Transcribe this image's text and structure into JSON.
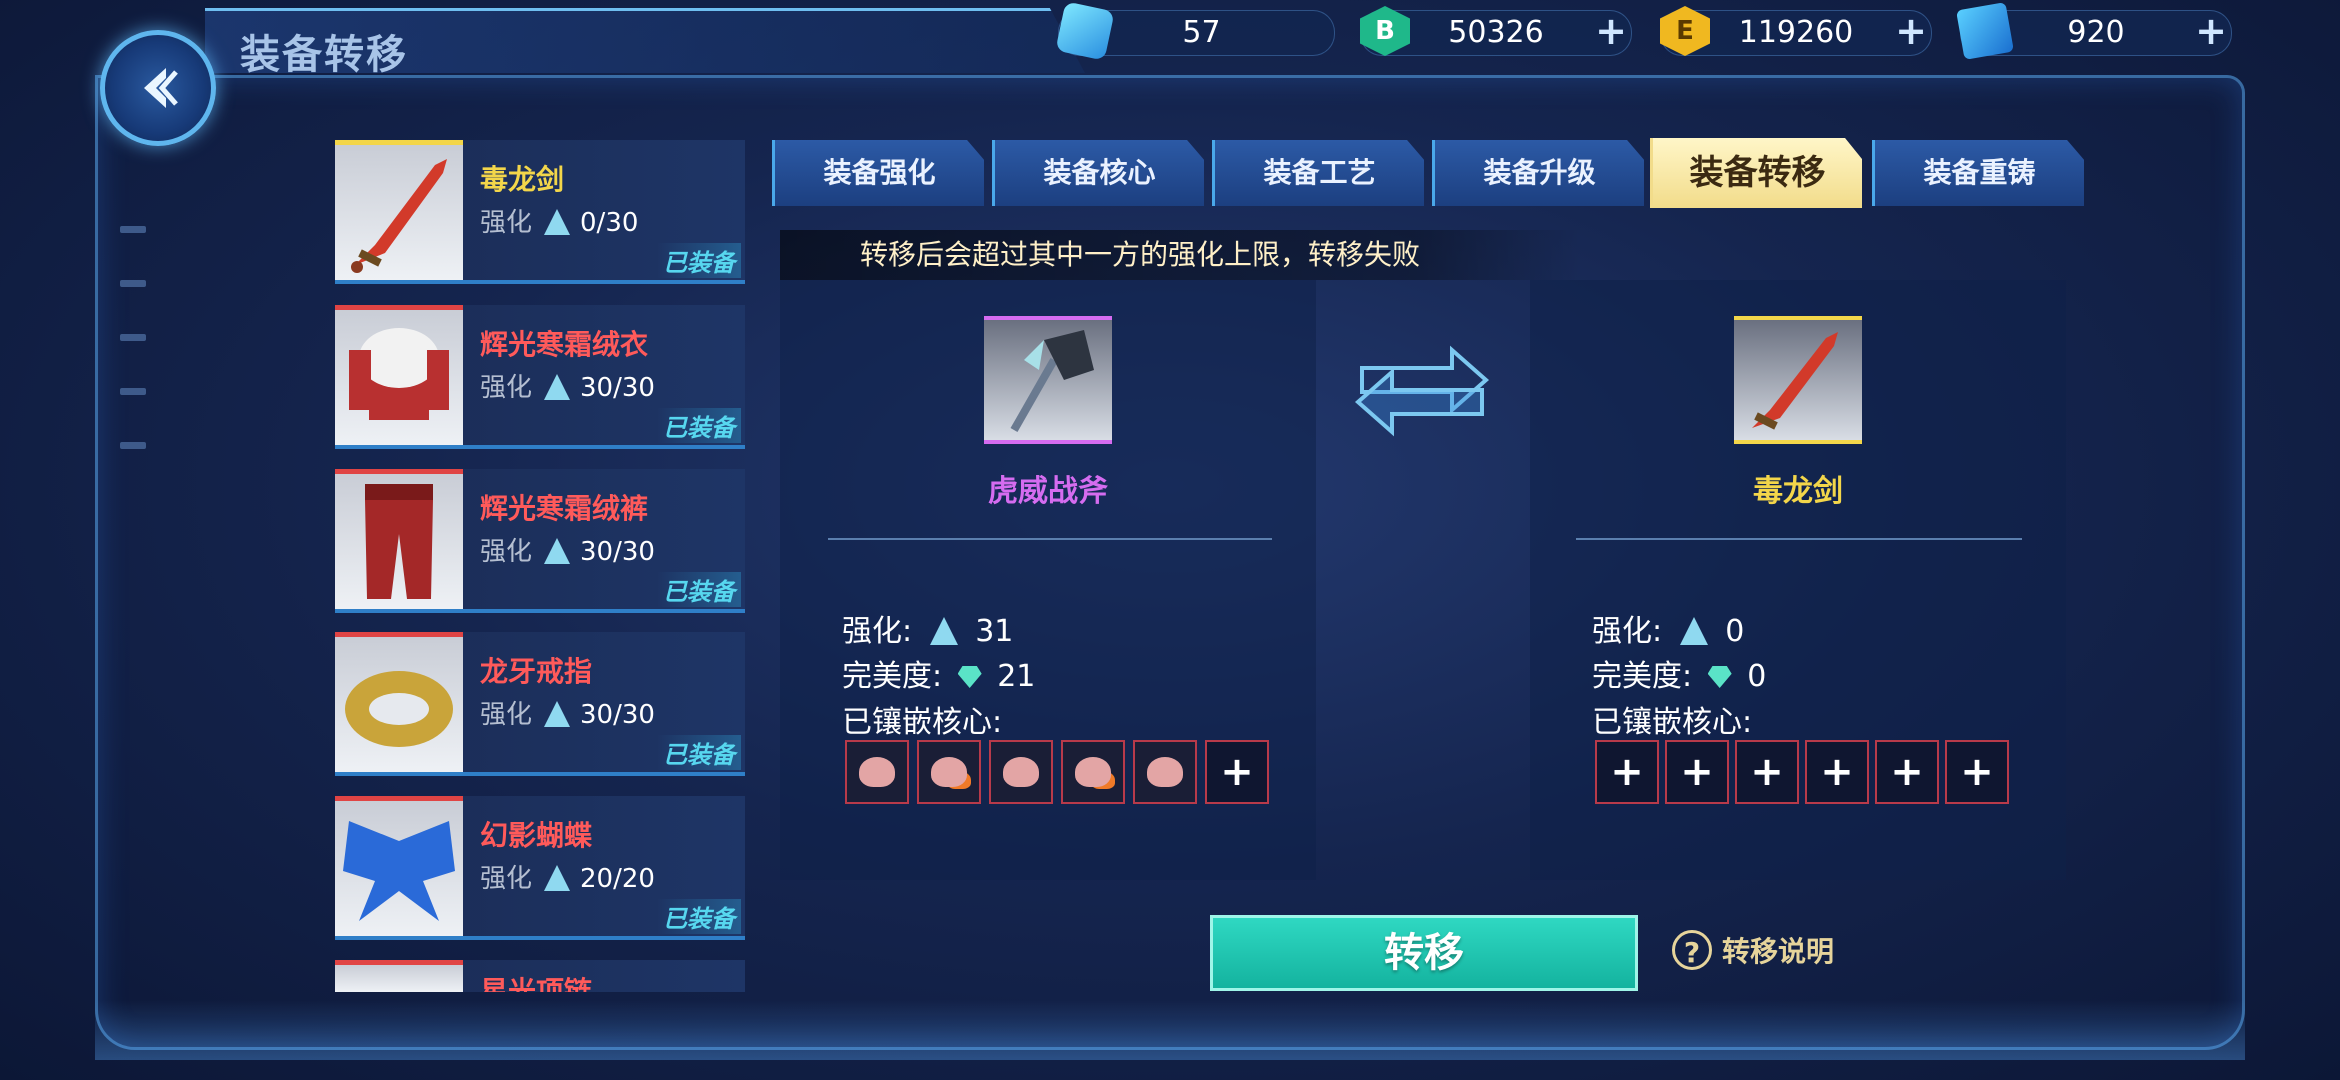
{
  "header": {
    "title": "装备转移"
  },
  "currencies": [
    {
      "icon": "gem-icon",
      "value": "57"
    },
    {
      "icon": "b-coin-icon",
      "letter": "B",
      "value": "50326"
    },
    {
      "icon": "e-coin-icon",
      "letter": "E",
      "value": "119260"
    },
    {
      "icon": "ticket-icon",
      "value": "920"
    }
  ],
  "equipment": [
    {
      "name": "毒龙剑",
      "label": "强化",
      "level": "0/30",
      "status": "已装备",
      "icon": "poison-dragon-sword-icon"
    },
    {
      "name": "辉光寒霜绒衣",
      "label": "强化",
      "level": "30/30",
      "status": "已装备",
      "icon": "frost-coat-icon"
    },
    {
      "name": "辉光寒霜绒裤",
      "label": "强化",
      "level": "30/30",
      "status": "已装备",
      "icon": "frost-pants-icon"
    },
    {
      "name": "龙牙戒指",
      "label": "强化",
      "level": "30/30",
      "status": "已装备",
      "icon": "dragon-fang-ring-icon"
    },
    {
      "name": "幻影蝴蝶",
      "label": "强化",
      "level": "20/20",
      "status": "已装备",
      "icon": "phantom-butterfly-icon"
    },
    {
      "name": "星光项链",
      "icon": "necklace-icon"
    }
  ],
  "tabs": [
    "装备强化",
    "装备核心",
    "装备工艺",
    "装备升级",
    "装备转移",
    "装备重铸"
  ],
  "active_tab": "装备转移",
  "notice": "转移后会超过其中一方的强化上限，转移失败",
  "source": {
    "name": "虎威战斧",
    "name_color": "#d56cf0",
    "strengthen_label": "强化:",
    "strengthen": "31",
    "perfection_label": "完美度:",
    "perfection": "21",
    "cores_label": "已镶嵌核心:",
    "cores_filled": 5,
    "cores_empty": 1
  },
  "target": {
    "name": "毒龙剑",
    "name_color": "#f3d64a",
    "strengthen_label": "强化:",
    "strengthen": "0",
    "perfection_label": "完美度:",
    "perfection": "0",
    "cores_label": "已镶嵌核心:",
    "cores_filled": 0,
    "cores_empty": 6
  },
  "transfer_button": "转移",
  "help_label": "转移说明"
}
